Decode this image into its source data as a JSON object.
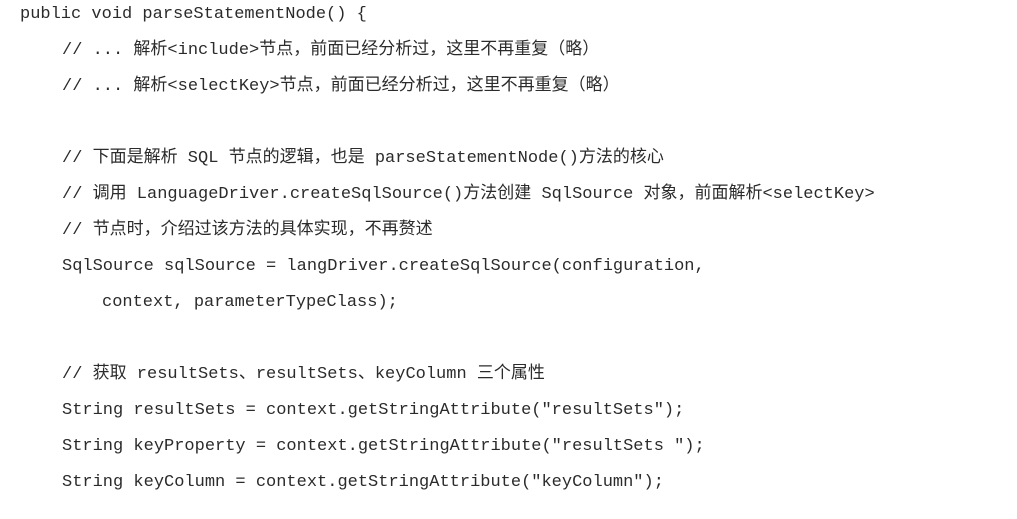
{
  "code": {
    "lines": [
      "public void parseStatementNode() {",
      "// ... 解析<include>节点，前面已经分析过，这里不再重复（略）",
      "// ... 解析<selectKey>节点，前面已经分析过，这里不再重复（略）",
      "",
      "// 下面是解析 SQL 节点的逻辑，也是 parseStatementNode()方法的核心",
      "// 调用 LanguageDriver.createSqlSource()方法创建 SqlSource 对象，前面解析<selectKey>",
      "// 节点时，介绍过该方法的具体实现，不再赘述",
      "SqlSource sqlSource = langDriver.createSqlSource(configuration,",
      "context, parameterTypeClass);",
      "",
      "// 获取 resultSets、resultSets、keyColumn 三个属性",
      "String resultSets = context.getStringAttribute(\"resultSets\");",
      "String keyProperty = context.getStringAttribute(\"resultSets \");",
      "String keyColumn = context.getStringAttribute(\"keyColumn\");"
    ]
  }
}
